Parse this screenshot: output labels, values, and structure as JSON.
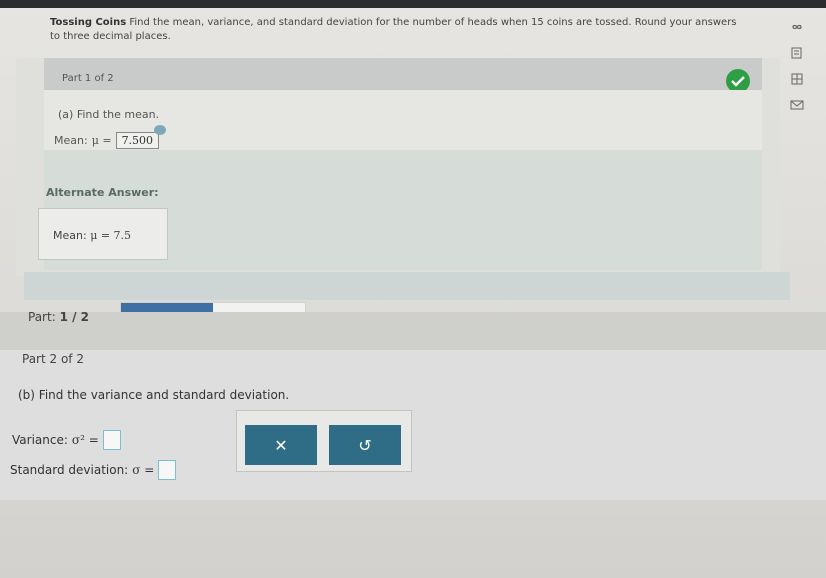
{
  "question": {
    "title": "Tossing Coins",
    "text": "Find the mean, variance, and standard deviation for the number of heads when 15 coins are tossed. Round your answers to three decimal places."
  },
  "part1": {
    "label": "Part 1 of 2",
    "status_icon": "check-icon",
    "question_a": "(a) Find the mean.",
    "mean_label": "Mean:",
    "mean_symbol": "μ =",
    "mean_value": "7.500",
    "alternate_title": "Alternate Answer:",
    "alternate_label": "Mean:",
    "alternate_value": "μ = 7.5"
  },
  "progress": {
    "label": "Part:",
    "value": "1 / 2",
    "fraction": 0.5,
    "fill_color": "#3f6fa3"
  },
  "part2": {
    "label": "Part 2 of 2",
    "question_b": "(b) Find the variance and standard deviation.",
    "variance_label": "Variance:",
    "variance_symbol": "σ² =",
    "sd_label": "Standard deviation:",
    "sd_symbol": "σ =",
    "variance_value": "",
    "sd_value": ""
  },
  "buttons": {
    "clear": "✕",
    "undo": "↺"
  },
  "colors": {
    "check_green": "#2e9e44",
    "button_blue": "#2f6d87"
  }
}
